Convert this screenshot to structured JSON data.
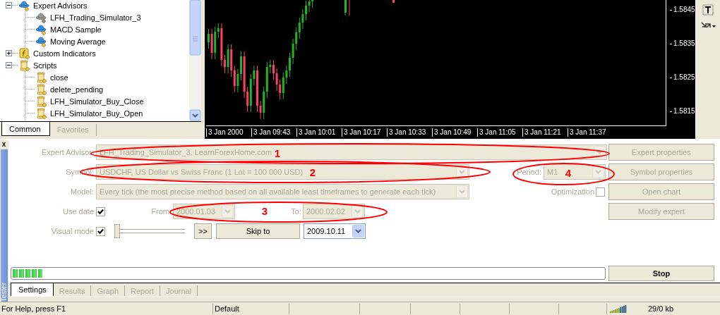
{
  "navigator": {
    "tree": [
      {
        "label": "Expert Advisors",
        "kind": "advisor",
        "expanded": true,
        "children": [
          {
            "label": "LFH_Trading_Simulator_3",
            "kind": "advisor-off"
          },
          {
            "label": "MACD Sample",
            "kind": "advisor"
          },
          {
            "label": "Moving Average",
            "kind": "advisor"
          }
        ]
      },
      {
        "label": "Custom Indicators",
        "kind": "indicator",
        "expanded": false
      },
      {
        "label": "Scripts",
        "kind": "script",
        "expanded": true,
        "children": [
          {
            "label": "close",
            "kind": "script"
          },
          {
            "label": "delete_pending",
            "kind": "script"
          },
          {
            "label": "LFH_Simulator_Buy_Close",
            "kind": "script"
          },
          {
            "label": "LFH_Simulator_Buy_Open",
            "kind": "script"
          }
        ]
      }
    ],
    "tabs": [
      {
        "label": "Common",
        "selected": true
      },
      {
        "label": "Favorites",
        "selected": false
      }
    ]
  },
  "chart": {
    "price_labels": [
      "1.5845",
      "1.5835",
      "1.5825",
      "1.5815"
    ],
    "time_labels": [
      "3 Jan 2000",
      "3 Jan 09:43",
      "3 Jan 10:01",
      "3 Jan 10:17",
      "3 Jan 10:33",
      "3 Jan 10:49",
      "3 Jan 11:05",
      "3 Jan 11:21",
      "3 Jan 11:37"
    ]
  },
  "tester": {
    "title": "Tester",
    "close": "x",
    "expert_advisor": {
      "label": "Expert Advisor:",
      "value": "LFH_Trading_Simulator_3, LearnForexHome.com",
      "disabled": true
    },
    "symbol": {
      "label": "Symbol:",
      "value": "USDCHF, US Dollar vs Swiss Franc (1 Lot = 100 000 USD)",
      "disabled": true
    },
    "period": {
      "label": "Period:",
      "value": "M1",
      "disabled": true
    },
    "model": {
      "label": "Model:",
      "value": "Every tick (the most precise method based on all available least timeframes to generate each tick)",
      "disabled": true
    },
    "optimization": {
      "label": "Optimization",
      "checked": false,
      "disabled": true
    },
    "use_date": {
      "label": "Use date",
      "checked": true,
      "disabled": true
    },
    "from": {
      "label": "From:",
      "value": "2000.01.03",
      "disabled": true
    },
    "to": {
      "label": "To:",
      "value": "2000.02.02",
      "disabled": true
    },
    "visual_mode": {
      "label": "Visual mode",
      "checked": true,
      "disabled": true
    },
    "speed_slider": {
      "level": 0
    },
    "fast_forward": ">>",
    "skip_to": "Skip to",
    "skip_date": {
      "value": "2009.10.11",
      "disabled": false
    },
    "buttons": [
      {
        "label": "Expert properties",
        "disabled": true
      },
      {
        "label": "Symbol properties",
        "disabled": true
      },
      {
        "label": "Open chart",
        "disabled": true
      },
      {
        "label": "Modify expert",
        "disabled": true
      }
    ],
    "progress": {
      "level": 0.05
    },
    "stop": "Stop",
    "tabs": [
      {
        "label": "Settings",
        "selected": true
      },
      {
        "label": "Results",
        "selected": false
      },
      {
        "label": "Graph",
        "selected": false
      },
      {
        "label": "Report",
        "selected": false
      },
      {
        "label": "Journal",
        "selected": false
      }
    ]
  },
  "annotations": [
    {
      "label": "1"
    },
    {
      "label": "2"
    },
    {
      "label": "3"
    },
    {
      "label": "4"
    }
  ],
  "status_bar": {
    "help": "For Help, press F1",
    "profile": "Default",
    "traffic": "29/0 kb"
  }
}
